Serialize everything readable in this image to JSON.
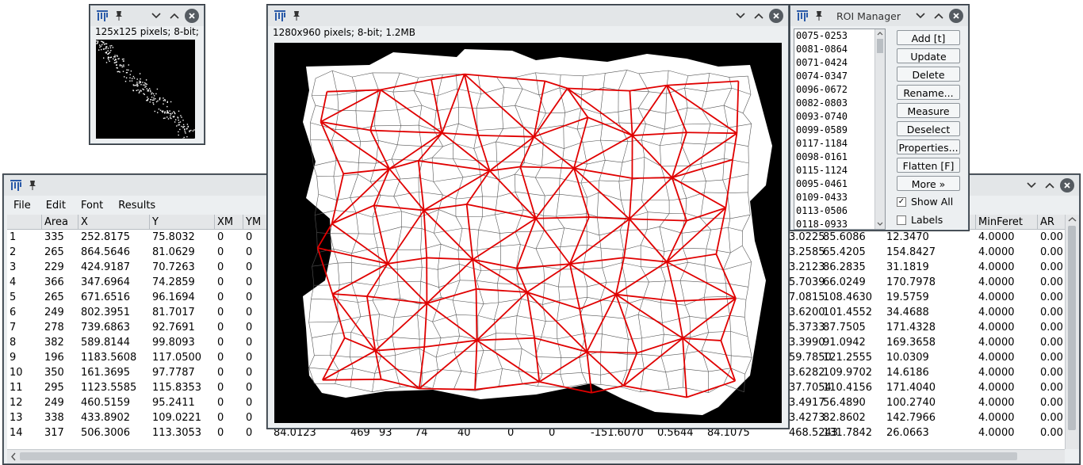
{
  "small_image": {
    "info": "125x125 pixels; 8-bit;"
  },
  "main_image": {
    "info": "1280x960 pixels; 8-bit; 1.2MB"
  },
  "results": {
    "menu": [
      "File",
      "Edit",
      "Font",
      "Results"
    ],
    "left_headers": [
      "",
      "Area",
      "X",
      "Y",
      "XM",
      "YM"
    ],
    "right_headers": [
      "MinFeret",
      "AR"
    ],
    "rows": [
      {
        "n": "1",
        "area": "335",
        "x": "252.8175",
        "y": "75.8032",
        "xm": "0",
        "ym": "0",
        "r": [
          "3.0225",
          "85.6086",
          "12.3470",
          "4.0000",
          "0.00"
        ]
      },
      {
        "n": "2",
        "area": "265",
        "x": "864.5646",
        "y": "81.0629",
        "xm": "0",
        "ym": "0",
        "r": [
          "3.2585",
          "65.4205",
          "154.8427",
          "4.0000",
          "0.00"
        ]
      },
      {
        "n": "3",
        "area": "229",
        "x": "424.9187",
        "y": "70.7263",
        "xm": "0",
        "ym": "0",
        "r": [
          "3.2123",
          "86.2835",
          "31.1819",
          "4.0000",
          "0.00"
        ]
      },
      {
        "n": "4",
        "area": "366",
        "x": "347.6964",
        "y": "74.2859",
        "xm": "0",
        "ym": "0",
        "r": [
          "5.7039",
          "66.0249",
          "170.7978",
          "4.0000",
          "0.00"
        ]
      },
      {
        "n": "5",
        "area": "265",
        "x": "671.6516",
        "y": "96.1694",
        "xm": "0",
        "ym": "0",
        "r": [
          "7.0815",
          "108.4630",
          "19.5759",
          "4.0000",
          "0.00"
        ]
      },
      {
        "n": "6",
        "area": "249",
        "x": "802.3951",
        "y": "81.7017",
        "xm": "0",
        "ym": "0",
        "r": [
          "3.6200",
          "101.4552",
          "34.4688",
          "4.0000",
          "0.00"
        ]
      },
      {
        "n": "7",
        "area": "278",
        "x": "739.6863",
        "y": "92.7691",
        "xm": "0",
        "ym": "0",
        "r": [
          "5.3733",
          "87.7505",
          "171.4328",
          "4.0000",
          "0.00"
        ]
      },
      {
        "n": "8",
        "area": "382",
        "x": "589.8144",
        "y": "99.8093",
        "xm": "0",
        "ym": "0",
        "r": [
          "3.3990",
          "91.0942",
          "169.3658",
          "4.0000",
          "0.00"
        ]
      },
      {
        "n": "9",
        "area": "196",
        "x": "1183.5608",
        "y": "117.0500",
        "xm": "0",
        "ym": "0",
        "r": [
          "59.7850",
          "121.2555",
          "10.0309",
          "4.0000",
          "0.00"
        ]
      },
      {
        "n": "10",
        "area": "350",
        "x": "161.3695",
        "y": "97.7787",
        "xm": "0",
        "ym": "0",
        "r": [
          "3.6282",
          "109.9702",
          "14.6186",
          "4.0000",
          "0.00"
        ]
      },
      {
        "n": "11",
        "area": "295",
        "x": "1123.5585",
        "y": "115.8353",
        "xm": "0",
        "ym": "0",
        "r": [
          "37.7054",
          "110.4156",
          "171.4040",
          "4.0000",
          "0.00"
        ]
      },
      {
        "n": "12",
        "area": "249",
        "x": "460.5159",
        "y": "95.2411",
        "xm": "0",
        "ym": "0",
        "r": [
          "3.4917",
          "56.4890",
          "100.2740",
          "4.0000",
          "0.00"
        ]
      },
      {
        "n": "13",
        "area": "338",
        "x": "433.8902",
        "y": "109.0221",
        "xm": "0",
        "ym": "0",
        "r": [
          "3.4273",
          "82.8602",
          "142.7966",
          "4.0000",
          "0.00"
        ]
      },
      {
        "n": "14",
        "area": "317",
        "x": "506.3006",
        "y": "113.3053",
        "xm": "0",
        "ym": "0",
        "r": [
          "468.5243",
          "131.7842",
          "26.0663",
          "4.0000",
          "0.00"
        ]
      }
    ],
    "row14_mid": [
      "84.0123",
      "469",
      "93",
      "74",
      "40",
      "0",
      "0",
      "-151.6070",
      "0.5644",
      "84.1075"
    ]
  },
  "roi_manager": {
    "title": "ROI Manager",
    "items": [
      "0075-0253",
      "0081-0864",
      "0071-0424",
      "0074-0347",
      "0096-0672",
      "0082-0803",
      "0093-0740",
      "0099-0589",
      "0117-1184",
      "0098-0161",
      "0115-1124",
      "0095-0461",
      "0109-0433",
      "0113-0506",
      "0118-0933"
    ],
    "buttons": [
      "Add [t]",
      "Update",
      "Delete",
      "Rename...",
      "Measure",
      "Deselect",
      "Properties...",
      "Flatten [F]",
      "More »"
    ],
    "show_all": "Show All",
    "labels": "Labels"
  }
}
